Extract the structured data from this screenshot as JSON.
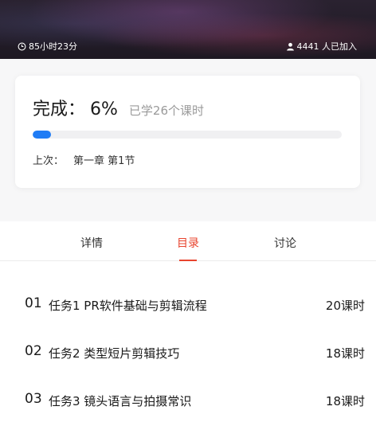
{
  "header": {
    "duration": "85小时23分",
    "joined": "4441 人已加入"
  },
  "progress": {
    "label": "完成：",
    "percent_text": "6%",
    "percent_value": 6,
    "learned": "已学26个课时",
    "last_prefix": "上次：",
    "last_chapter": "第一章 第1节"
  },
  "tabs": [
    {
      "label": "详情",
      "active": false
    },
    {
      "label": "目录",
      "active": true
    },
    {
      "label": "讨论",
      "active": false
    }
  ],
  "courses": [
    {
      "num": "01",
      "title": "任务1 PR软件基础与剪辑流程",
      "hours": "20课时"
    },
    {
      "num": "02",
      "title": "任务2 类型短片剪辑技巧",
      "hours": "18课时"
    },
    {
      "num": "03",
      "title": "任务3 镜头语言与拍摄常识",
      "hours": "18课时"
    }
  ],
  "colors": {
    "accent": "#e8442e",
    "progress": "#1f7cf5"
  }
}
